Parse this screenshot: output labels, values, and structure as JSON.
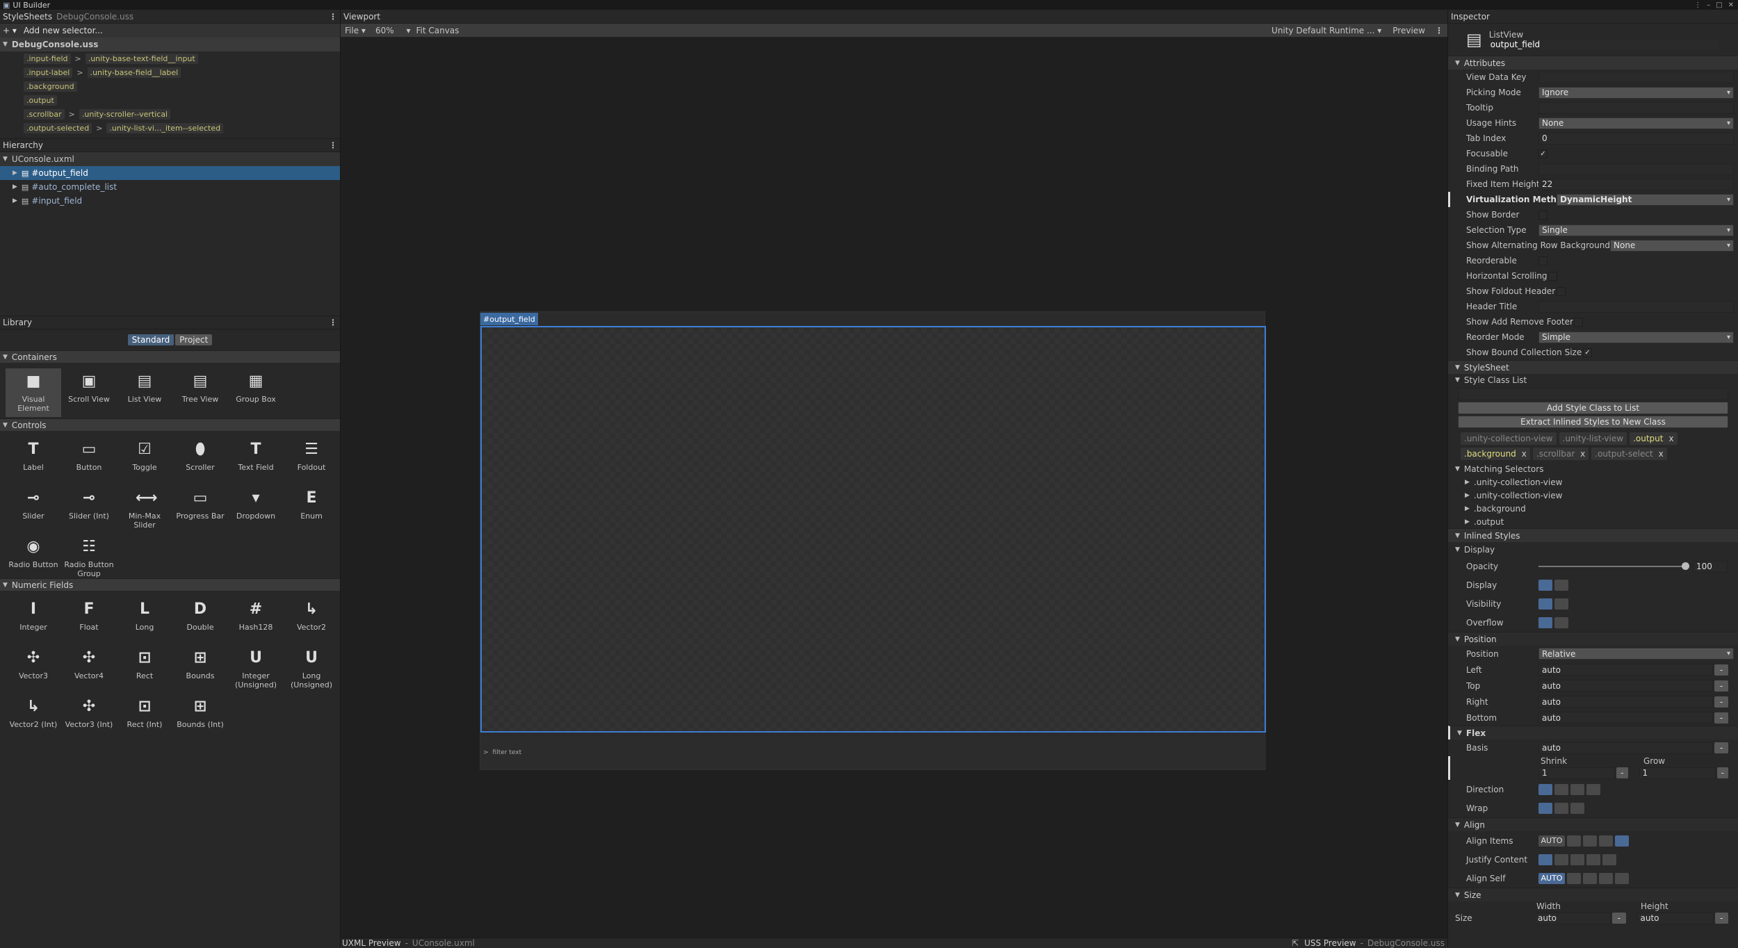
{
  "window": {
    "title": "UI Builder"
  },
  "stylesheets": {
    "title": "StyleSheets",
    "file": "DebugConsole.uss",
    "add_placeholder": "Add new selector...",
    "sheet_name": "DebugConsole.uss",
    "selectors": [
      {
        "a": ".input-field",
        "b": ".unity-base-text-field__input"
      },
      {
        "a": ".input-label",
        "b": ".unity-base-field__label"
      },
      {
        "a": ".background",
        "b": ""
      },
      {
        "a": ".output",
        "b": ""
      },
      {
        "a": ".scrollbar",
        "b": ".unity-scroller--vertical"
      },
      {
        "a": ".output-selected",
        "b": ".unity-list-vi..._item--selected"
      }
    ]
  },
  "hierarchy": {
    "title": "Hierarchy",
    "root": "UConsole.uxml",
    "items": [
      "#output_field",
      "#auto_complete_list",
      "#input_field"
    ]
  },
  "library": {
    "title": "Library",
    "tab_standard": "Standard",
    "tab_project": "Project",
    "containers_title": "Containers",
    "containers": [
      "Visual Element",
      "Scroll View",
      "List View",
      "Tree View",
      "Group Box"
    ],
    "controls_title": "Controls",
    "controls": [
      "Label",
      "Button",
      "Toggle",
      "Scroller",
      "Text Field",
      "Foldout",
      "Slider",
      "Slider (Int)",
      "Min-Max Slider",
      "Progress Bar",
      "Dropdown",
      "Enum",
      "Radio Button",
      "Radio Button Group"
    ],
    "numeric_title": "Numeric Fields",
    "numeric": [
      "Integer",
      "Float",
      "Long",
      "Double",
      "Hash128",
      "Vector2",
      "Vector3",
      "Vector4",
      "Rect",
      "Bounds",
      "Integer (Unsigned)",
      "Long (Unsigned)",
      "Vector2 (Int)",
      "Vector3 (Int)",
      "Rect (Int)",
      "Bounds (Int)"
    ]
  },
  "viewport": {
    "title": "Viewport",
    "file": "File",
    "zoom": "60%",
    "fit": "Fit Canvas",
    "theme": "Unity Default Runtime ...",
    "preview": "Preview",
    "selected_tag": "#output_field",
    "filter_text": "filter text"
  },
  "bottom": {
    "uxml_preview": "UXML Preview",
    "uxml_file": "UConsole.uxml",
    "uss_preview": "USS Preview",
    "uss_file": "DebugConsole.uss"
  },
  "inspector": {
    "title": "Inspector",
    "type": "ListView",
    "name": "output_field",
    "attributes_title": "Attributes",
    "view_data_key": "View Data Key",
    "picking_mode": "Picking Mode",
    "picking_mode_val": "Ignore",
    "tooltip": "Tooltip",
    "usage_hints": "Usage Hints",
    "usage_hints_val": "None",
    "tab_index": "Tab Index",
    "tab_index_val": "0",
    "focusable": "Focusable",
    "binding_path": "Binding Path",
    "fixed_item_height": "Fixed Item Height",
    "fixed_item_height_val": "22",
    "virtualization": "Virtualization Method",
    "virtualization_val": "DynamicHeight",
    "show_border": "Show Border",
    "selection_type": "Selection Type",
    "selection_type_val": "Single",
    "alt_rows": "Show Alternating Row Backgrounds",
    "alt_rows_val": "None",
    "reorderable": "Reorderable",
    "horizontal_scrolling": "Horizontal Scrolling",
    "show_foldout_header": "Show Foldout Header",
    "header_title": "Header Title",
    "show_add_remove": "Show Add Remove Footer",
    "reorder_mode": "Reorder Mode",
    "reorder_mode_val": "Simple",
    "show_bound_size": "Show Bound Collection Size",
    "stylesheet_title": "StyleSheet",
    "style_class_list": "Style Class List",
    "add_class_btn": "Add Style Class to List",
    "extract_btn": "Extract Inlined Styles to New Class",
    "classes": [
      ".unity-collection-view",
      ".unity-list-view",
      ".output",
      ".background",
      ".scrollbar",
      ".output-select"
    ],
    "matching_title": "Matching Selectors",
    "matching": [
      ".unity-collection-view",
      ".unity-collection-view",
      ".background",
      ".output"
    ],
    "inlined_title": "Inlined Styles",
    "display_title": "Display",
    "opacity": "Opacity",
    "opacity_val": "100",
    "display": "Display",
    "visibility": "Visibility",
    "overflow": "Overflow",
    "position_title": "Position",
    "position": "Position",
    "position_val": "Relative",
    "left": "Left",
    "top": "Top",
    "right": "Right",
    "bottom": "Bottom",
    "auto": "auto",
    "flex_title": "Flex",
    "basis": "Basis",
    "shrink": "Shrink",
    "grow": "Grow",
    "one": "1",
    "direction": "Direction",
    "wrap": "Wrap",
    "align_title": "Align",
    "align_items": "Align Items",
    "justify_content": "Justify Content",
    "align_self": "Align Self",
    "auto_btn": "AUTO",
    "size_title": "Size",
    "size": "Size",
    "width": "Width",
    "height": "Height"
  }
}
